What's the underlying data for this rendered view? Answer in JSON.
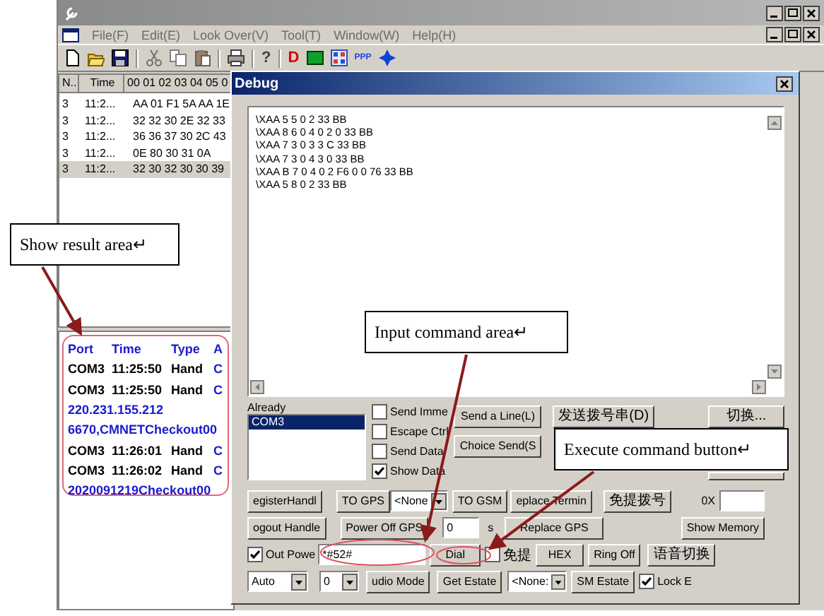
{
  "main_window": {
    "menu": [
      "File(F)",
      "Edit(E)",
      "Look Over(V)",
      "Tool(T)",
      "Window(W)",
      "Help(H)"
    ],
    "toolbar": [
      {
        "kind": "new"
      },
      {
        "kind": "open"
      },
      {
        "kind": "save"
      },
      {
        "kind": "sep"
      },
      {
        "kind": "cut"
      },
      {
        "kind": "copy"
      },
      {
        "kind": "paste"
      },
      {
        "kind": "sep"
      },
      {
        "kind": "print"
      },
      {
        "kind": "sep"
      },
      {
        "kind": "text",
        "text": "?",
        "color": "#404040"
      },
      {
        "kind": "sep"
      },
      {
        "kind": "text",
        "text": "D",
        "color": "#e00000"
      },
      {
        "kind": "green-square"
      },
      {
        "kind": "grid"
      },
      {
        "kind": "small-text",
        "text": "PPP",
        "color": "#2040e0"
      },
      {
        "kind": "diamond"
      }
    ],
    "table": {
      "columns": [
        "N..",
        "Time",
        "00 01 02 03 04 05 0"
      ],
      "rows": [
        {
          "cells": [
            "3",
            "11:2...",
            "AA 01 F1 5A AA 1E"
          ],
          "selected": false
        },
        {
          "cells": [
            "3",
            "11:2...",
            "32 32 30 2E 32 33"
          ],
          "selected": false
        },
        {
          "cells": [
            "3",
            "11:2...",
            "36 36 37 30 2C 43"
          ],
          "selected": false
        },
        {
          "cells": [
            "3",
            "11:2...",
            "0E 80 30 31 0A"
          ],
          "selected": false
        },
        {
          "cells": [
            "3",
            "11:2...",
            "32 30 32 30 30 39"
          ],
          "selected": true
        }
      ]
    },
    "results": {
      "columns": [
        "Port",
        "Time",
        "Type",
        "A"
      ],
      "rows": [
        {
          "kind": "record",
          "cells": [
            "COM3",
            "11:25:50",
            "Hand",
            "C"
          ]
        },
        {
          "kind": "record",
          "cells": [
            "COM3",
            "11:25:50",
            "Hand",
            "C"
          ]
        },
        {
          "kind": "data",
          "text": "220.231.155.212"
        },
        {
          "kind": "data",
          "text": "6670,CMNETCheckout00"
        },
        {
          "kind": "record",
          "cells": [
            "COM3",
            "11:26:01",
            "Hand",
            "C"
          ]
        },
        {
          "kind": "record",
          "cells": [
            "COM3",
            "11:26:02",
            "Hand",
            "C"
          ]
        },
        {
          "kind": "data",
          "text": "2020091219Checkout00"
        }
      ]
    }
  },
  "debug": {
    "title": "Debug",
    "log": [
      "\\XAA 5 5 0 2 33 BB",
      "\\XAA 8 6 0 4 0 2 0 33 BB",
      "\\XAA 7 3 0 3 3 C 33 BB",
      "\\XAA 7 3 0 4 3 0 33 BB",
      "\\XAA B 7 0 4 0 2 F6 0 0 76 33 BB",
      "\\XAA 5 8 0 2 33 BB"
    ],
    "ports_label": "Already",
    "ports": [
      {
        "label": "COM3",
        "selected": true
      }
    ],
    "options": [
      {
        "label": "Send Imme",
        "checked": false
      },
      {
        "label": "Escape Ctrl",
        "checked": false
      },
      {
        "label": "Send Data",
        "checked": false
      },
      {
        "label": "Show Data",
        "checked": true
      }
    ],
    "send_buttons": [
      "Send a Line(L)",
      "Choice Send(S"
    ],
    "dial_string_button": "发送拨号串(D)",
    "switch_button": "切换...",
    "controls": [
      [
        {
          "kind": "button",
          "label": "egisterHandl"
        },
        {
          "kind": "button",
          "label": "TO GPS"
        },
        {
          "kind": "combo",
          "value": "<None"
        },
        {
          "kind": "button",
          "label": "TO GSM"
        },
        {
          "kind": "button",
          "label": "eplace Termin"
        },
        {
          "kind": "button",
          "label": "免提拨号"
        },
        {
          "kind": "label",
          "label": "0X"
        },
        {
          "kind": "field"
        }
      ],
      [
        {
          "kind": "button",
          "label": "ogout Handle"
        },
        {
          "kind": "button",
          "label": "Power Off GPS"
        },
        {
          "kind": "field",
          "value": "0"
        },
        {
          "kind": "label",
          "label": "s"
        },
        {
          "kind": "button",
          "label": "Replace GPS"
        },
        {
          "kind": "button",
          "label": "Show Memory"
        }
      ],
      [
        {
          "kind": "checkbox",
          "label": "Out Powe",
          "checked": true
        },
        {
          "kind": "field",
          "value": "*#52#"
        },
        {
          "kind": "button",
          "label": "Dial"
        },
        {
          "kind": "checkbox",
          "label": "免提",
          "checked": false
        },
        {
          "kind": "button",
          "label": "HEX"
        },
        {
          "kind": "button",
          "label": "Ring Off"
        },
        {
          "kind": "button",
          "label": "语音切换"
        }
      ],
      [
        {
          "kind": "combo",
          "value": "Auto"
        },
        {
          "kind": "combo",
          "value": "0"
        },
        {
          "kind": "button",
          "label": "udio Mode"
        },
        {
          "kind": "button",
          "label": "Get Estate"
        },
        {
          "kind": "combo",
          "value": "<None:"
        },
        {
          "kind": "button",
          "label": "SM Estate"
        },
        {
          "kind": "checkbox",
          "label": "Lock E",
          "checked": true
        }
      ]
    ]
  },
  "annotations": [
    {
      "text": "Show result area↵"
    },
    {
      "text": "Input command area↵"
    },
    {
      "text": "Execute command button↵"
    }
  ]
}
